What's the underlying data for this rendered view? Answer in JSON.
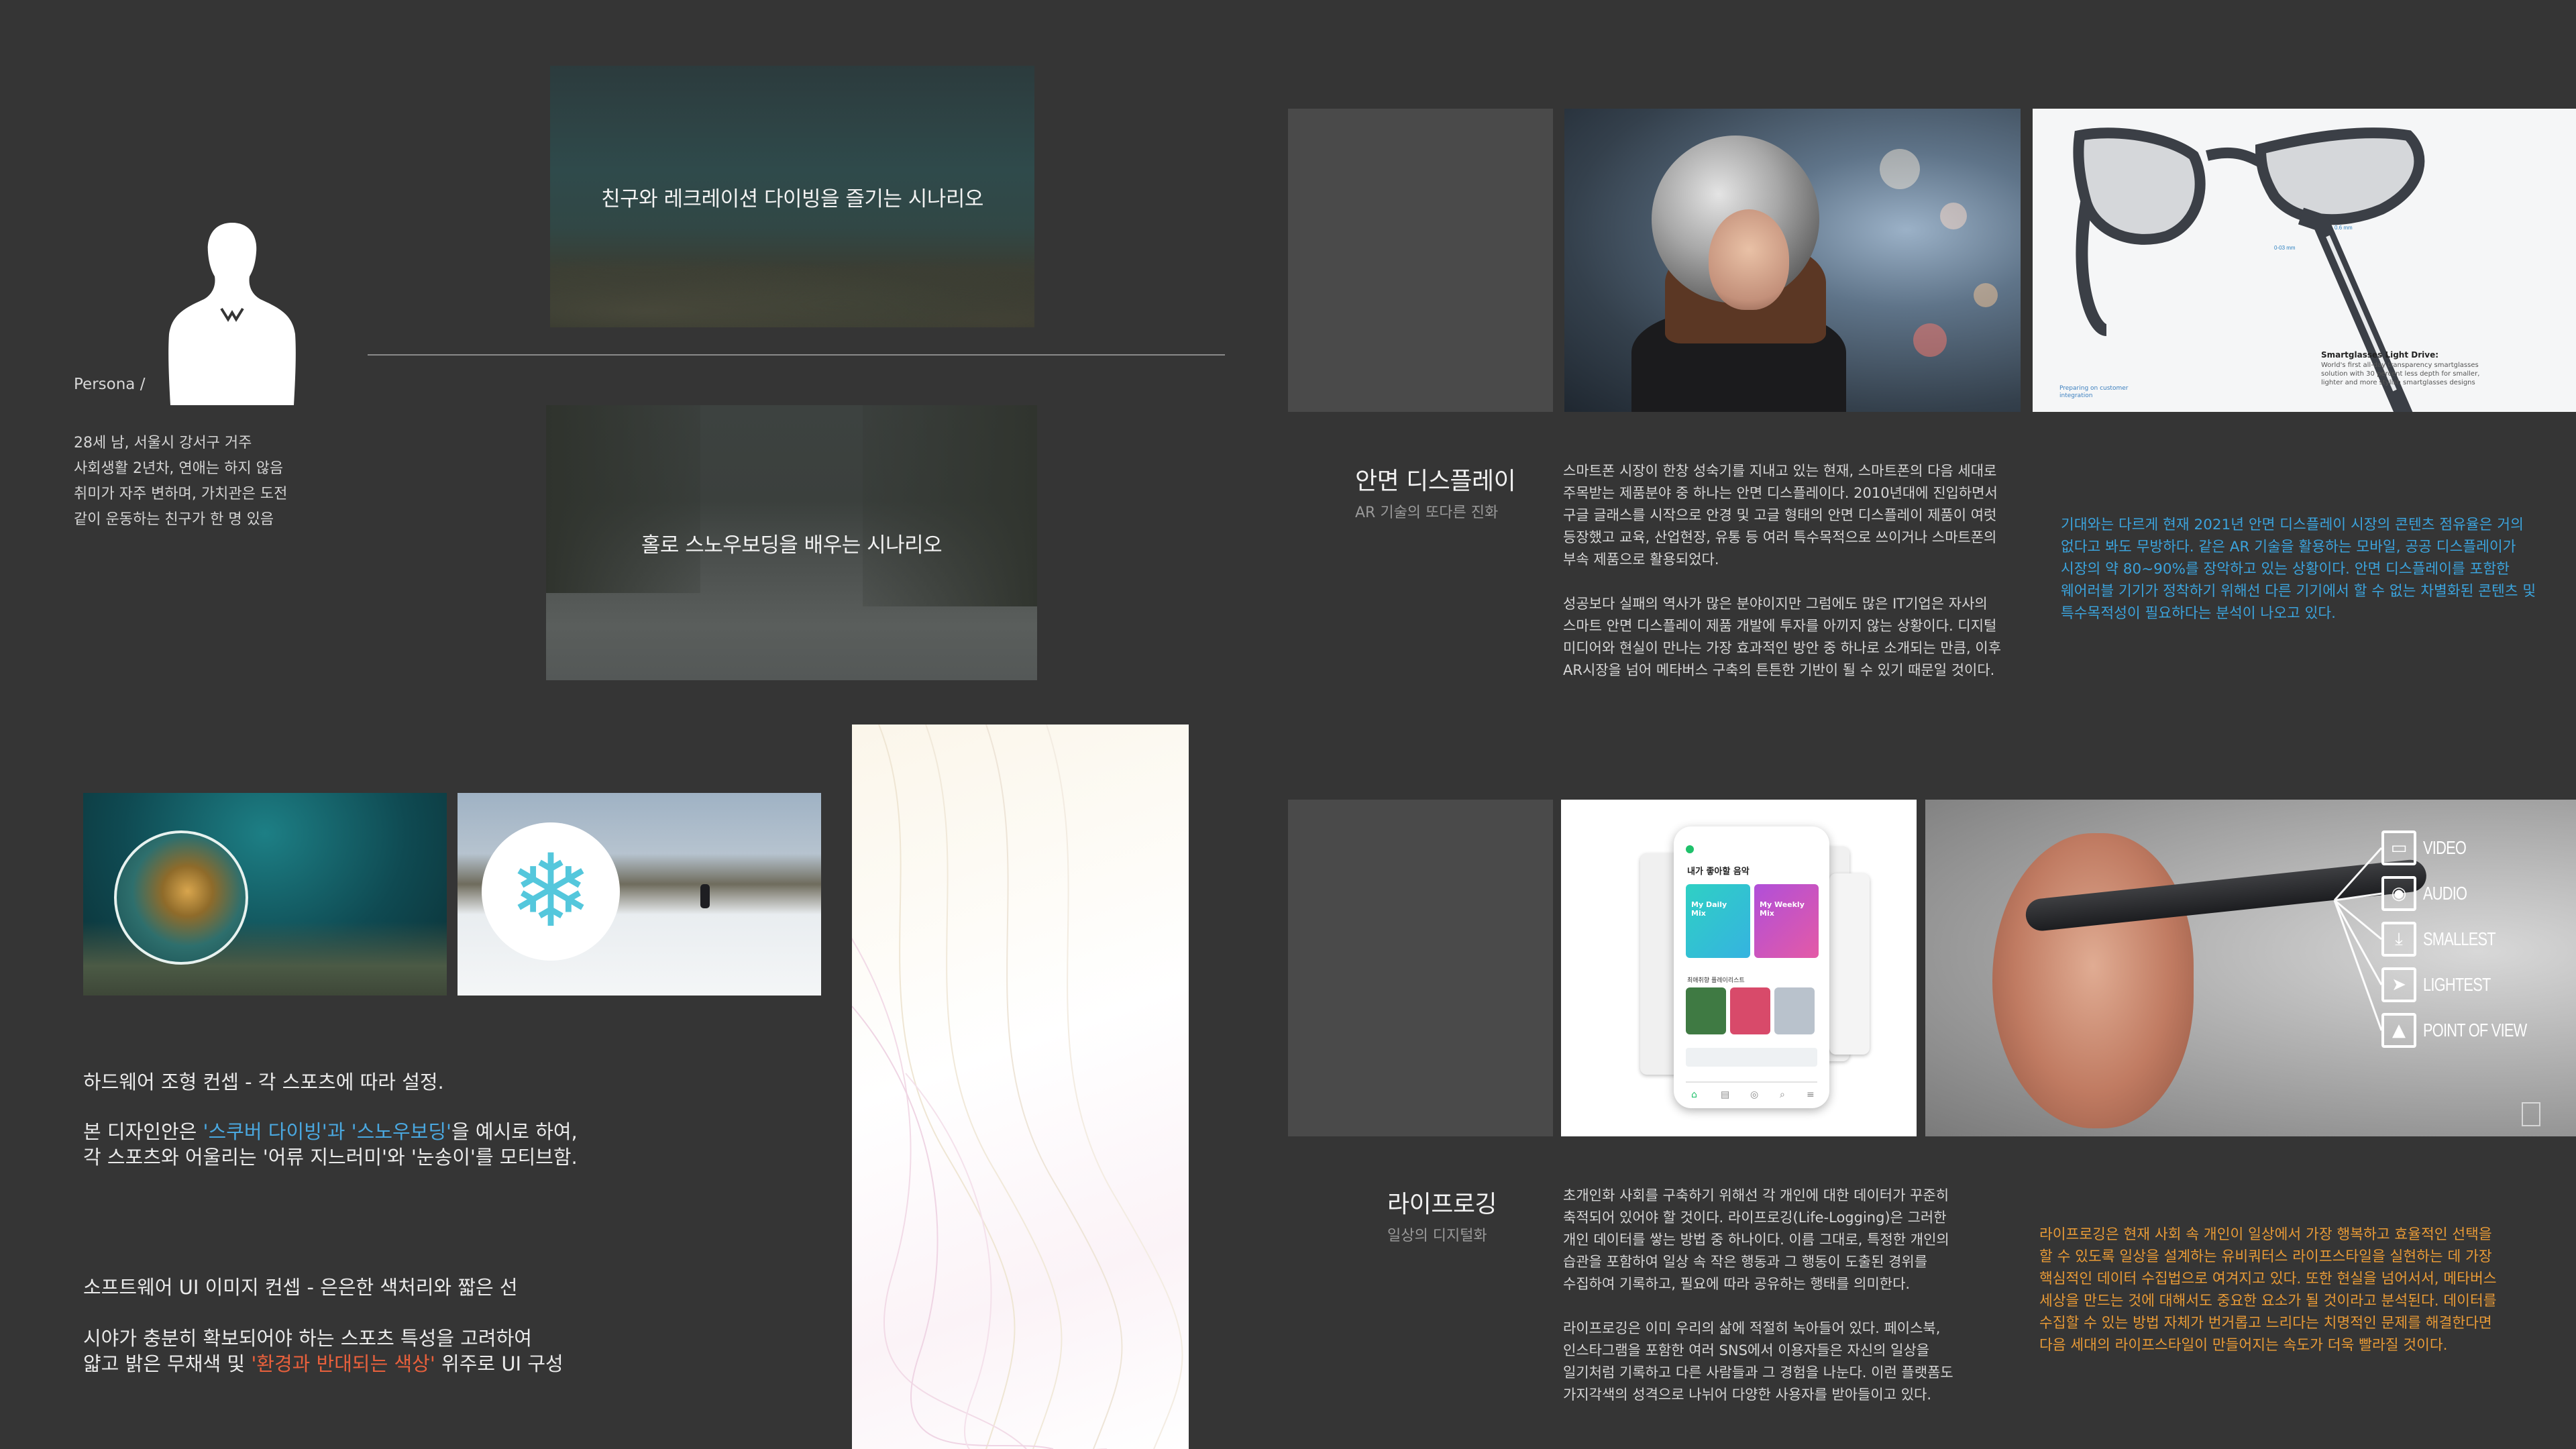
{
  "persona": {
    "label": "Persona /",
    "bio": [
      "28세 남, 서울시 강서구 거주",
      "사회생활 2년차, 연애는 하지 않음",
      "취미가 자주 변하며, 가치관은 도전",
      "같이 운동하는 친구가 한 명 있음"
    ]
  },
  "scenarios": {
    "diving": "친구와 레크레이션 다이빙을 즐기는 시나리오",
    "snowboard": "홀로 스노우보딩을 배우는 시나리오"
  },
  "concepts": {
    "hardware_heading": "하드웨어 조형 컨셉 - 각 스포츠에 따라 설정.",
    "hardware_line1_a": "본 디자인안은 ",
    "hardware_line1_highlight": "'스쿠버 다이빙'과 '스노우보딩'",
    "hardware_line1_b": "을 예시로 하여,",
    "hardware_line2": "각 스포츠와 어울리는 '어류 지느러미'와 '눈송이'를 모티브함.",
    "software_heading": "소프트웨어 UI 이미지 컨셉 - 은은한 색처리와 짧은 선",
    "software_line1": "시야가 충분히 확보되어야 하는 스포츠 특성을 고려하여",
    "software_line2_a": "얇고 밝은 무채색 및 ",
    "software_line2_highlight": "'환경과 반대되는 색상'",
    "software_line2_b": " 위주로 UI 구성"
  },
  "ar_display": {
    "title": "안면 디스플레이",
    "subtitle": "AR 기술의 또다른 진화",
    "glasses_caption_title": "Smartglasses Light Drive:",
    "glasses_caption_body": "World's first all-day transparency smartglasses solution with 30 percent less depth for smaller, lighter and more stylish smartglasses designs",
    "glasses_footer": "Preparing on customer integration",
    "paragraph1": [
      "스마트폰 시장이 한창 성숙기를 지내고 있는 현재, 스마트폰의 다음 세대로",
      "주목받는 제품분야 중 하나는 안면 디스플레이다. 2010년대에 진입하면서",
      "구글 글래스를 시작으로 안경 및 고글 형태의 안면 디스플레이 제품이 여럿",
      "등장했고 교육, 산업현장, 유통 등 여러 특수목적으로 쓰이거나 스마트폰의",
      "부속 제품으로 활용되었다."
    ],
    "paragraph2": [
      "성공보다 실패의 역사가 많은 분야이지만 그럼에도 많은 IT기업은 자사의",
      "스마트 안면 디스플레이 제품 개발에 투자를 아끼지 않는 상황이다. 디지털",
      "미디어와 현실이 만나는 가장 효과적인 방안 중 하나로 소개되는 만큼, 이후",
      "AR시장을 넘어 메타버스 구축의 튼튼한 기반이 될 수 있기 때문일 것이다."
    ],
    "insight": [
      "기대와는 다르게 현재 2021년 안면 디스플레이 시장의 콘텐츠 점유율은 거의",
      "없다고 봐도 무방하다. 같은 AR 기술을 활용하는 모바일, 공공 디스플레이가",
      "시장의 약 80~90%를 장악하고 있는 상황이다. 안면 디스플레이를 포함한",
      "웨어러블 기기가 정착하기 위해선 다른 기기에서 할 수 없는 차별화된 콘텐츠 및",
      "특수목적성이 필요하다는 분석이 나오고 있다."
    ]
  },
  "lifelogging": {
    "title": "라이프로깅",
    "subtitle": "일상의 디지털화",
    "app_title": "내가 좋아할 음악",
    "app_section": "최애취향 플레이리스트",
    "app_tile1": "My Daily Mix",
    "app_tile2": "My Weekly Mix",
    "features": [
      "VIDEO",
      "AUDIO",
      "SMALLEST",
      "LIGHTEST",
      "POINT OF VIEW"
    ],
    "paragraph1": [
      "초개인화 사회를 구축하기 위해선 각 개인에 대한 데이터가 꾸준히",
      "축적되어 있어야 할 것이다. 라이프로깅(Life-Logging)은 그러한",
      "개인 데이터를 쌓는 방법 중 하나이다. 이름 그대로, 특정한 개인의",
      "습관을 포함하여 일상 속 작은 행동과 그 행동이 도출된 경위를",
      "수집하여 기록하고, 필요에 따라 공유하는 행태를 의미한다."
    ],
    "paragraph2": [
      "라이프로깅은 이미 우리의 삶에 적절히 녹아들어 있다. 페이스북,",
      "인스타그램을 포함한 여러 SNS에서 이용자들은 자신의 일상을",
      "일기처럼 기록하고 다른 사람들과 그 경험을 나눈다. 이런 플랫폼도",
      "가지각색의 성격으로 나뉘어 다양한 사용자를 받아들이고 있다."
    ],
    "insight": [
      "라이프로깅은 현재 사회 속 개인이 일상에서 가장 행복하고 효율적인 선택을",
      "할 수 있도록 일상을 설계하는 유비쿼터스 라이프스타일을 실현하는 데 가장",
      "핵심적인 데이터 수집법으로 여겨지고 있다. 또한 현실을 넘어서서, 메타버스",
      "세상을 만드는 것에 대해서도 중요한 요소가 될 것이라고 분석된다. 데이터를",
      "수집할 수 있는 방법 자체가 번거롭고 느리다는 치명적인 문제를 해결한다면",
      "다음 세대의 라이프스타일이 만들어지는 속도가 더욱 빨라질 것이다."
    ]
  },
  "colors": {
    "background": "#353535",
    "accent_blue": "#3ba3dc",
    "accent_orange": "#e89a36",
    "highlight_red": "#e8603c"
  }
}
